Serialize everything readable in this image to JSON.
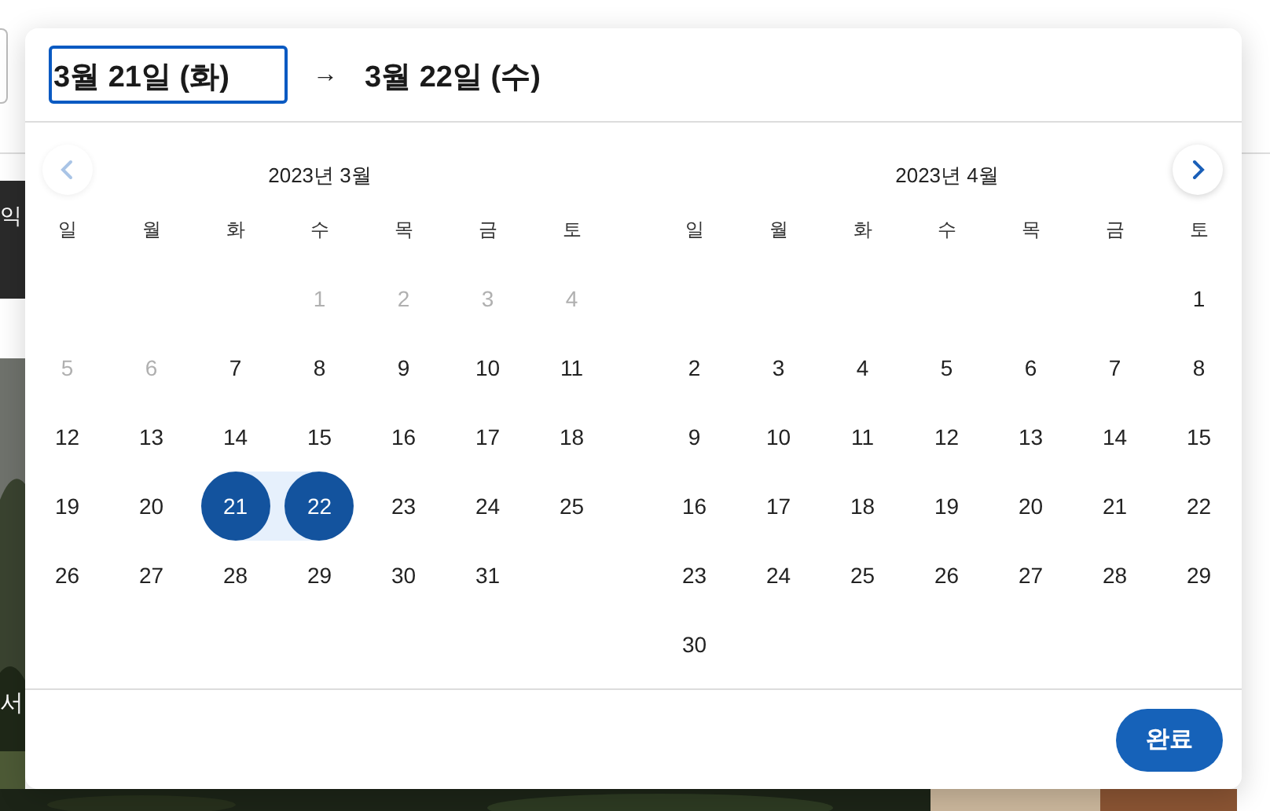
{
  "background": {
    "banner_text": "익",
    "photo_caption": "서"
  },
  "date_range": {
    "start": {
      "value": "3월 21일 (화)",
      "focused": true
    },
    "arrow": "→",
    "end": {
      "value": "3월 22일 (수)",
      "focused": false
    }
  },
  "navigation": {
    "previous": {
      "disabled": true
    },
    "next": {
      "disabled": false
    }
  },
  "months": [
    {
      "title": "2023년 3월",
      "weekdays": [
        "일",
        "월",
        "화",
        "수",
        "목",
        "금",
        "토"
      ],
      "weeks": [
        [
          {
            "kind": "blank"
          },
          {
            "kind": "blank"
          },
          {
            "kind": "blank"
          },
          {
            "kind": "day",
            "day": "1",
            "disabled": true,
            "selected": false
          },
          {
            "kind": "day",
            "day": "2",
            "disabled": true,
            "selected": false
          },
          {
            "kind": "day",
            "day": "3",
            "disabled": true,
            "selected": false
          },
          {
            "kind": "day",
            "day": "4",
            "disabled": true,
            "selected": false
          }
        ],
        [
          {
            "kind": "day",
            "day": "5",
            "disabled": true,
            "selected": false
          },
          {
            "kind": "day",
            "day": "6",
            "disabled": true,
            "selected": false
          },
          {
            "kind": "day",
            "day": "7",
            "disabled": false,
            "selected": false
          },
          {
            "kind": "day",
            "day": "8",
            "disabled": false,
            "selected": false
          },
          {
            "kind": "day",
            "day": "9",
            "disabled": false,
            "selected": false
          },
          {
            "kind": "day",
            "day": "10",
            "disabled": false,
            "selected": false
          },
          {
            "kind": "day",
            "day": "11",
            "disabled": false,
            "selected": false
          }
        ],
        [
          {
            "kind": "day",
            "day": "12",
            "disabled": false,
            "selected": false
          },
          {
            "kind": "day",
            "day": "13",
            "disabled": false,
            "selected": false
          },
          {
            "kind": "day",
            "day": "14",
            "disabled": false,
            "selected": false
          },
          {
            "kind": "day",
            "day": "15",
            "disabled": false,
            "selected": false
          },
          {
            "kind": "day",
            "day": "16",
            "disabled": false,
            "selected": false
          },
          {
            "kind": "day",
            "day": "17",
            "disabled": false,
            "selected": false
          },
          {
            "kind": "day",
            "day": "18",
            "disabled": false,
            "selected": false
          }
        ],
        [
          {
            "kind": "day",
            "day": "19",
            "disabled": false,
            "selected": false
          },
          {
            "kind": "day",
            "day": "20",
            "disabled": false,
            "selected": false
          },
          {
            "kind": "day",
            "day": "21",
            "disabled": false,
            "selected": true
          },
          {
            "kind": "day",
            "day": "22",
            "disabled": false,
            "selected": true
          },
          {
            "kind": "day",
            "day": "23",
            "disabled": false,
            "selected": false
          },
          {
            "kind": "day",
            "day": "24",
            "disabled": false,
            "selected": false
          },
          {
            "kind": "day",
            "day": "25",
            "disabled": false,
            "selected": false
          }
        ],
        [
          {
            "kind": "day",
            "day": "26",
            "disabled": false,
            "selected": false
          },
          {
            "kind": "day",
            "day": "27",
            "disabled": false,
            "selected": false
          },
          {
            "kind": "day",
            "day": "28",
            "disabled": false,
            "selected": false
          },
          {
            "kind": "day",
            "day": "29",
            "disabled": false,
            "selected": false
          },
          {
            "kind": "day",
            "day": "30",
            "disabled": false,
            "selected": false
          },
          {
            "kind": "day",
            "day": "31",
            "disabled": false,
            "selected": false
          },
          {
            "kind": "blank"
          }
        ]
      ]
    },
    {
      "title": "2023년 4월",
      "weekdays": [
        "일",
        "월",
        "화",
        "수",
        "목",
        "금",
        "토"
      ],
      "weeks": [
        [
          {
            "kind": "blank"
          },
          {
            "kind": "blank"
          },
          {
            "kind": "blank"
          },
          {
            "kind": "blank"
          },
          {
            "kind": "blank"
          },
          {
            "kind": "blank"
          },
          {
            "kind": "day",
            "day": "1",
            "disabled": false,
            "selected": false
          }
        ],
        [
          {
            "kind": "day",
            "day": "2",
            "disabled": false,
            "selected": false
          },
          {
            "kind": "day",
            "day": "3",
            "disabled": false,
            "selected": false
          },
          {
            "kind": "day",
            "day": "4",
            "disabled": false,
            "selected": false
          },
          {
            "kind": "day",
            "day": "5",
            "disabled": false,
            "selected": false
          },
          {
            "kind": "day",
            "day": "6",
            "disabled": false,
            "selected": false
          },
          {
            "kind": "day",
            "day": "7",
            "disabled": false,
            "selected": false
          },
          {
            "kind": "day",
            "day": "8",
            "disabled": false,
            "selected": false
          }
        ],
        [
          {
            "kind": "day",
            "day": "9",
            "disabled": false,
            "selected": false
          },
          {
            "kind": "day",
            "day": "10",
            "disabled": false,
            "selected": false
          },
          {
            "kind": "day",
            "day": "11",
            "disabled": false,
            "selected": false
          },
          {
            "kind": "day",
            "day": "12",
            "disabled": false,
            "selected": false
          },
          {
            "kind": "day",
            "day": "13",
            "disabled": false,
            "selected": false
          },
          {
            "kind": "day",
            "day": "14",
            "disabled": false,
            "selected": false
          },
          {
            "kind": "day",
            "day": "15",
            "disabled": false,
            "selected": false
          }
        ],
        [
          {
            "kind": "day",
            "day": "16",
            "disabled": false,
            "selected": false
          },
          {
            "kind": "day",
            "day": "17",
            "disabled": false,
            "selected": false
          },
          {
            "kind": "day",
            "day": "18",
            "disabled": false,
            "selected": false
          },
          {
            "kind": "day",
            "day": "19",
            "disabled": false,
            "selected": false
          },
          {
            "kind": "day",
            "day": "20",
            "disabled": false,
            "selected": false
          },
          {
            "kind": "day",
            "day": "21",
            "disabled": false,
            "selected": false
          },
          {
            "kind": "day",
            "day": "22",
            "disabled": false,
            "selected": false
          }
        ],
        [
          {
            "kind": "day",
            "day": "23",
            "disabled": false,
            "selected": false
          },
          {
            "kind": "day",
            "day": "24",
            "disabled": false,
            "selected": false
          },
          {
            "kind": "day",
            "day": "25",
            "disabled": false,
            "selected": false
          },
          {
            "kind": "day",
            "day": "26",
            "disabled": false,
            "selected": false
          },
          {
            "kind": "day",
            "day": "27",
            "disabled": false,
            "selected": false
          },
          {
            "kind": "day",
            "day": "28",
            "disabled": false,
            "selected": false
          },
          {
            "kind": "day",
            "day": "29",
            "disabled": false,
            "selected": false
          }
        ],
        [
          {
            "kind": "day",
            "day": "30",
            "disabled": false,
            "selected": false
          },
          {
            "kind": "blank"
          },
          {
            "kind": "blank"
          },
          {
            "kind": "blank"
          },
          {
            "kind": "blank"
          },
          {
            "kind": "blank"
          },
          {
            "kind": "blank"
          }
        ]
      ]
    }
  ],
  "done_button": "완료"
}
